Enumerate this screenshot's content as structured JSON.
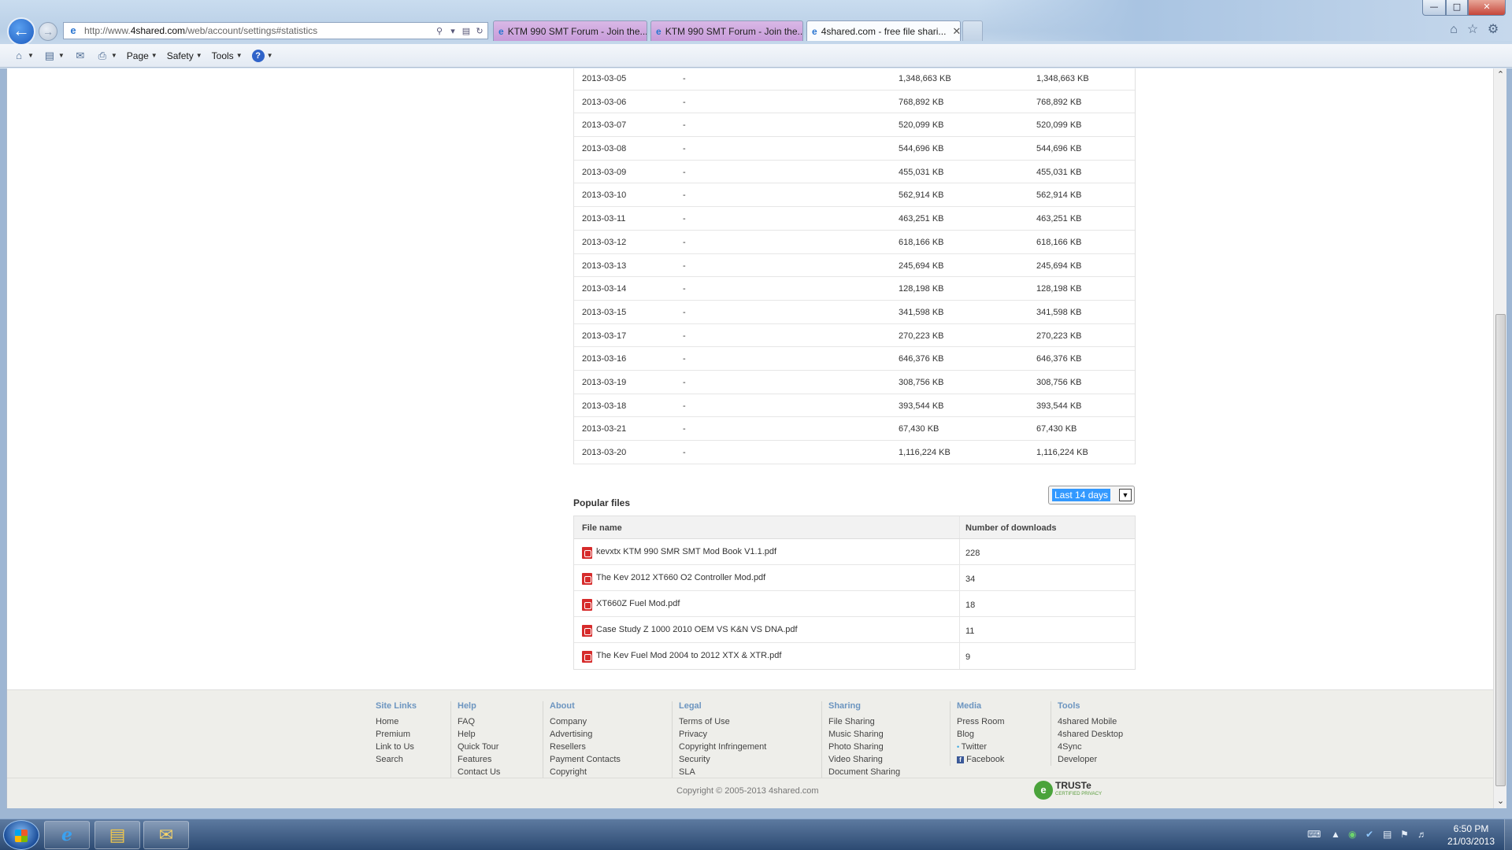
{
  "browser": {
    "url_prefix": "http://www.",
    "url_domain": "4shared.com",
    "url_path": "/web/account/settings#statistics",
    "tabs": [
      {
        "title": "KTM 990 SMT Forum - Join the..."
      },
      {
        "title": "KTM 990 SMT Forum - Join the..."
      },
      {
        "title": "4shared.com - free file shari..."
      }
    ],
    "command_bar": {
      "page": "Page",
      "safety": "Safety",
      "tools": "Tools"
    },
    "colors": {
      "tab_inactive": "#c79bd9",
      "accent": "#1c5bbf"
    }
  },
  "statistics": {
    "rows": [
      {
        "date": "2013-03-05",
        "col2": "-",
        "col3": "1,348,663 KB",
        "col4": "1,348,663 KB"
      },
      {
        "date": "2013-03-06",
        "col2": "-",
        "col3": "768,892 KB",
        "col4": "768,892 KB"
      },
      {
        "date": "2013-03-07",
        "col2": "-",
        "col3": "520,099 KB",
        "col4": "520,099 KB"
      },
      {
        "date": "2013-03-08",
        "col2": "-",
        "col3": "544,696 KB",
        "col4": "544,696 KB"
      },
      {
        "date": "2013-03-09",
        "col2": "-",
        "col3": "455,031 KB",
        "col4": "455,031 KB"
      },
      {
        "date": "2013-03-10",
        "col2": "-",
        "col3": "562,914 KB",
        "col4": "562,914 KB"
      },
      {
        "date": "2013-03-11",
        "col2": "-",
        "col3": "463,251 KB",
        "col4": "463,251 KB"
      },
      {
        "date": "2013-03-12",
        "col2": "-",
        "col3": "618,166 KB",
        "col4": "618,166 KB"
      },
      {
        "date": "2013-03-13",
        "col2": "-",
        "col3": "245,694 KB",
        "col4": "245,694 KB"
      },
      {
        "date": "2013-03-14",
        "col2": "-",
        "col3": "128,198 KB",
        "col4": "128,198 KB"
      },
      {
        "date": "2013-03-15",
        "col2": "-",
        "col3": "341,598 KB",
        "col4": "341,598 KB"
      },
      {
        "date": "2013-03-17",
        "col2": "-",
        "col3": "270,223 KB",
        "col4": "270,223 KB"
      },
      {
        "date": "2013-03-16",
        "col2": "-",
        "col3": "646,376 KB",
        "col4": "646,376 KB"
      },
      {
        "date": "2013-03-19",
        "col2": "-",
        "col3": "308,756 KB",
        "col4": "308,756 KB"
      },
      {
        "date": "2013-03-18",
        "col2": "-",
        "col3": "393,544 KB",
        "col4": "393,544 KB"
      },
      {
        "date": "2013-03-21",
        "col2": "-",
        "col3": "67,430 KB",
        "col4": "67,430 KB"
      },
      {
        "date": "2013-03-20",
        "col2": "-",
        "col3": "1,116,224 KB",
        "col4": "1,116,224 KB"
      }
    ]
  },
  "popular": {
    "title": "Popular files",
    "period": "Last 14 days",
    "header_file": "File name",
    "header_downloads": "Number of downloads",
    "files": [
      {
        "name": "kevxtx KTM 990 SMR SMT Mod Book V1.1.pdf",
        "downloads": "228"
      },
      {
        "name": "The Kev 2012 XT660 O2 Controller Mod.pdf",
        "downloads": "34"
      },
      {
        "name": "XT660Z Fuel Mod.pdf",
        "downloads": "18"
      },
      {
        "name": "Case Study Z 1000 2010 OEM VS K&N VS DNA.pdf",
        "downloads": "11"
      },
      {
        "name": "The Kev Fuel Mod 2004 to 2012 XTX & XTR.pdf",
        "downloads": "9"
      }
    ]
  },
  "footer": {
    "columns": [
      {
        "title": "Site Links",
        "links": [
          "Home",
          "Premium",
          "Link to Us",
          "Search"
        ]
      },
      {
        "title": "Help",
        "links": [
          "FAQ",
          "Help",
          "Quick Tour",
          "Features",
          "Contact Us"
        ]
      },
      {
        "title": "About",
        "links": [
          "Company",
          "Advertising",
          "Resellers",
          "Payment Contacts",
          "Copyright"
        ]
      },
      {
        "title": "Legal",
        "links": [
          "Terms of Use",
          "Privacy",
          "Copyright Infringement",
          "Security",
          "SLA"
        ]
      },
      {
        "title": "Sharing",
        "links": [
          "File Sharing",
          "Music Sharing",
          "Photo Sharing",
          "Video Sharing",
          "Document Sharing"
        ]
      },
      {
        "title": "Media",
        "links": [
          "Press Room",
          "Blog",
          "Twitter",
          "Facebook"
        ]
      },
      {
        "title": "Tools",
        "links": [
          "4shared Mobile",
          "4shared Desktop",
          "4Sync",
          "Developer"
        ]
      }
    ],
    "copyright": "Copyright © 2005-2013 4shared.com",
    "truste": "TRUSTe",
    "truste_sub": "CERTIFIED PRIVACY"
  },
  "taskbar": {
    "time": "6:50 PM",
    "date": "21/03/2013"
  }
}
